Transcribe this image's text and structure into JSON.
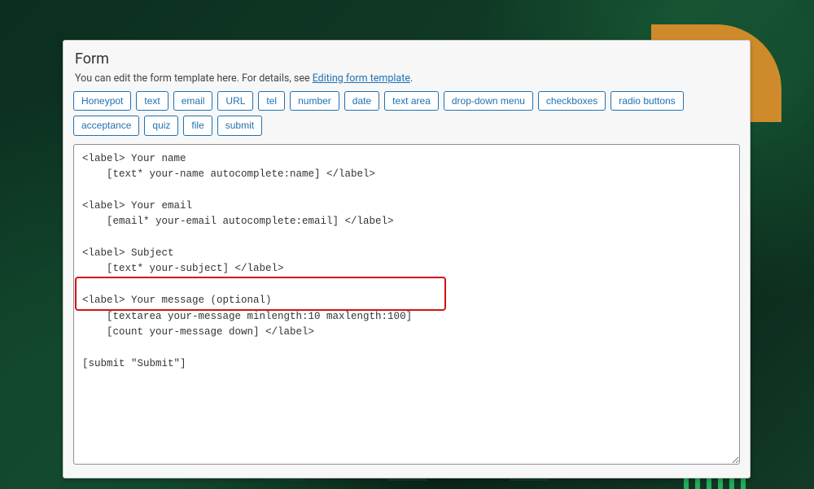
{
  "panel": {
    "title": "Form",
    "description_prefix": "You can edit the form template here. For details, see ",
    "description_link": "Editing form template",
    "description_suffix": "."
  },
  "tags": [
    "Honeypot",
    "text",
    "email",
    "URL",
    "tel",
    "number",
    "date",
    "text area",
    "drop-down menu",
    "checkboxes",
    "radio buttons",
    "acceptance",
    "quiz",
    "file",
    "submit"
  ],
  "form_template": "<label> Your name\n    [text* your-name autocomplete:name] </label>\n\n<label> Your email\n    [email* your-email autocomplete:email] </label>\n\n<label> Subject\n    [text* your-subject] </label>\n\n<label> Your message (optional)\n    [textarea your-message minlength:10 maxlength:100]\n    [count your-message down] </label>\n\n[submit \"Submit\"]"
}
